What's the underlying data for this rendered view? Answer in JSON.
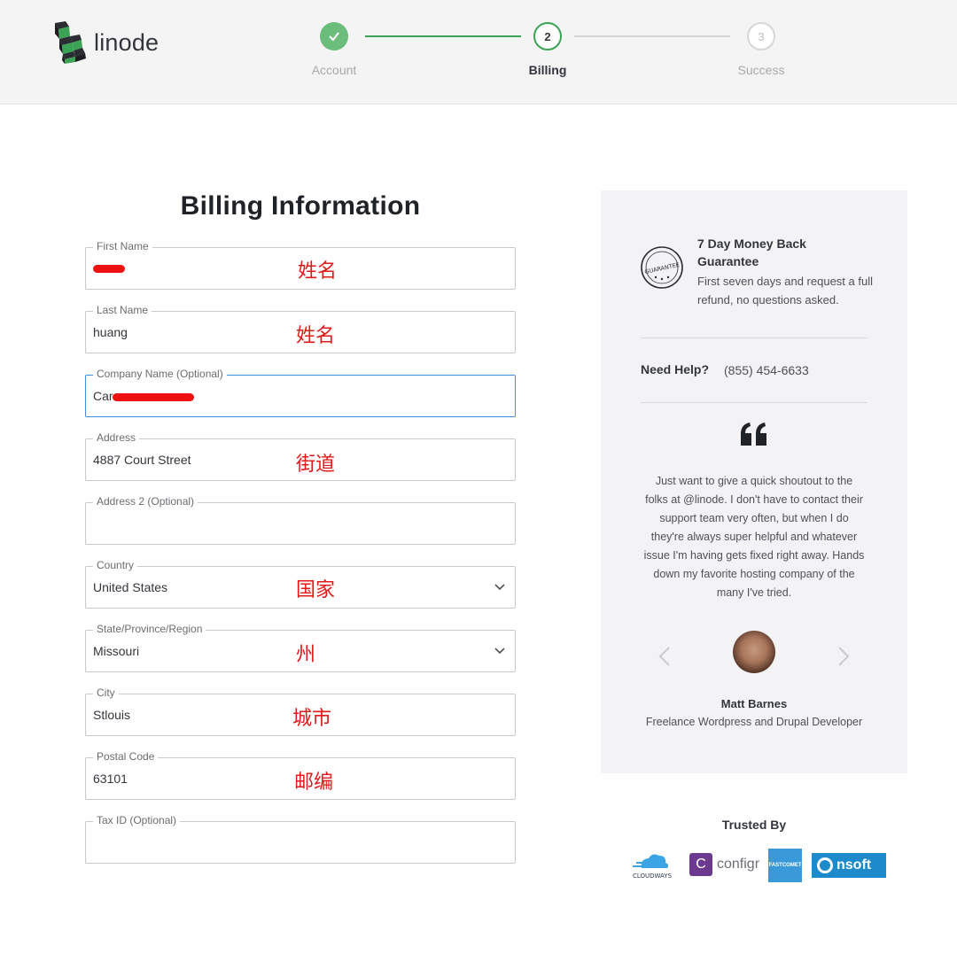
{
  "brand": {
    "name": "linode"
  },
  "stepper": {
    "steps": [
      {
        "number": "",
        "label": "Account",
        "state": "complete"
      },
      {
        "number": "2",
        "label": "Billing",
        "state": "active"
      },
      {
        "number": "3",
        "label": "Success",
        "state": "upcoming"
      }
    ]
  },
  "form": {
    "title": "Billing Information",
    "fields": [
      {
        "label": "First Name",
        "value": "",
        "annotation": "姓名"
      },
      {
        "label": "Last Name",
        "value": "huang",
        "annotation": "姓名"
      },
      {
        "label": "Company Name (Optional)",
        "value": "Car",
        "annotation": ""
      },
      {
        "label": "Address",
        "value": "4887 Court Street",
        "annotation": "街道"
      },
      {
        "label": "Address 2 (Optional)",
        "value": "",
        "annotation": ""
      },
      {
        "label": "Country",
        "value": "United States",
        "annotation": "国家"
      },
      {
        "label": "State/Province/Region",
        "value": "Missouri",
        "annotation": "州"
      },
      {
        "label": "City",
        "value": "Stlouis",
        "annotation": "城市"
      },
      {
        "label": "Postal Code",
        "value": "63101",
        "annotation": "邮编"
      },
      {
        "label": "Tax ID (Optional)",
        "value": "",
        "annotation": ""
      }
    ]
  },
  "sidebar": {
    "guarantee_title": "7 Day Money Back Guarantee",
    "guarantee_text": "First seven days and request a full refund, no questions asked.",
    "badge_text": "GUARANTEE",
    "help_label": "Need Help?",
    "help_phone": "(855) 454-6633",
    "testimonial": "Just want to give a quick shoutout to the folks at @linode. I don't have to contact their support team very often, but when I do they're always super helpful and whatever issue I'm having gets fixed right away. Hands down my favorite hosting company of the many I've tried.",
    "author_name": "Matt Barnes",
    "author_role": "Freelance Wordpress and Drupal Developer"
  },
  "trusted": {
    "title": "Trusted By",
    "logos": [
      "CLOUDWAYS",
      "configr",
      "FASTCOMET",
      "nsoft"
    ]
  },
  "colors": {
    "accent_green": "#3aa356",
    "focus_blue": "#3f8ee0",
    "annotation_red": "#e01919"
  }
}
